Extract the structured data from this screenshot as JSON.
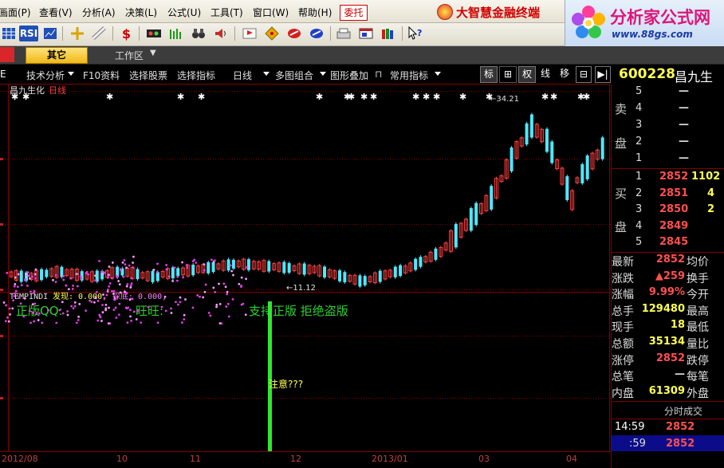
{
  "menu": [
    "画面(P)",
    "查看(V)",
    "分析(A)",
    "决策(L)",
    "公式(U)",
    "工具(T)",
    "窗口(W)",
    "帮助(H)"
  ],
  "weituo_label": "委托",
  "brand_text": "大智慧金融终端",
  "logo": {
    "title": "分析家公式网",
    "url": "www.88gs.com"
  },
  "toolbar_icons": [
    "grid-icon",
    "rsi-icon",
    "chart-grid-icon",
    "crosshair-icon",
    "ruler-icon",
    "dollar-icon",
    "dots-icon",
    "bars-icon",
    "binoculars-icon",
    "speaker-icon",
    "flag-icon",
    "diamond-icon",
    "red-ball-icon",
    "blue-ball-icon",
    "printer-icon",
    "window-icon",
    "books-icon",
    "help-cursor-icon"
  ],
  "toolbar_rsi": "RSI",
  "toolbar_dollar": "$",
  "tab": {
    "active_label": "其它",
    "workspace": "工作区",
    "arrow": "▼"
  },
  "funcbar": {
    "items": [
      "技术分析",
      "F10资料",
      "选择股票",
      "选择指标",
      "日线",
      "多图组合",
      "图形叠加",
      "常用指标"
    ],
    "right": [
      "标",
      "⊞",
      "权",
      "线",
      "移",
      "⊟",
      "▶|"
    ]
  },
  "stock": {
    "code": "600228",
    "name": "昌九生"
  },
  "chart": {
    "title": "昌九生化",
    "period": "日线",
    "high_label": "←34.21",
    "low_label": "←11.12",
    "indicator_name": "TEMPINDI",
    "indicator_found": "发现: 0.000,",
    "indicator_probe": "探底: 0.000,",
    "watermark_prefix": "正版QQ:",
    "watermark_mid": "旺旺:",
    "watermark_suffix": "支持正版  拒绝盗版",
    "notice": "注意???",
    "axis_dates": [
      "2012/08",
      "10",
      "11",
      "12",
      "2013/01",
      "03",
      "04"
    ]
  },
  "orderbook": {
    "sell_label": [
      "卖",
      "盘"
    ],
    "buy_label": [
      "买",
      "盘"
    ],
    "sells": [
      {
        "idx": "5",
        "price": "—",
        "vol": ""
      },
      {
        "idx": "4",
        "price": "—",
        "vol": ""
      },
      {
        "idx": "3",
        "price": "—",
        "vol": ""
      },
      {
        "idx": "2",
        "price": "—",
        "vol": ""
      },
      {
        "idx": "1",
        "price": "—",
        "vol": ""
      }
    ],
    "buys": [
      {
        "idx": "1",
        "price": "2852",
        "vol": "1102"
      },
      {
        "idx": "2",
        "price": "2851",
        "vol": "4"
      },
      {
        "idx": "3",
        "price": "2850",
        "vol": "2"
      },
      {
        "idx": "4",
        "price": "2849",
        "vol": ""
      },
      {
        "idx": "5",
        "price": "2845",
        "vol": ""
      }
    ]
  },
  "quote": [
    {
      "l": "最新",
      "v": "2852",
      "r": "均价",
      "color": "#ff5050"
    },
    {
      "l": "涨跌",
      "v": "▲259",
      "r": "换手",
      "color": "#ff5050"
    },
    {
      "l": "涨幅",
      "v": "9.99%",
      "r": "今开",
      "color": "#ff5050"
    },
    {
      "l": "总手",
      "v": "129480",
      "r": "最高",
      "color": "#ffff54"
    },
    {
      "l": "现手",
      "v": "18",
      "r": "最低",
      "color": "#ffff54"
    },
    {
      "l": "总额",
      "v": "35134",
      "r": "量比",
      "color": "#ffff54"
    },
    {
      "l": "涨停",
      "v": "2852",
      "r": "跌停",
      "color": "#ff5050"
    },
    {
      "l": "总笔",
      "v": "—",
      "r": "每笔",
      "color": "#ddd"
    },
    {
      "l": "内盘",
      "v": "61309",
      "r": "外盘",
      "color": "#ffff54"
    }
  ],
  "ticks": {
    "header": "分时成交",
    "rows": [
      {
        "time": "14:59",
        "price": "2852"
      },
      {
        "time": ":59",
        "price": "2852"
      }
    ]
  },
  "colors": {
    "up": "#ff4040",
    "down": "#4fe8ff",
    "grid": "#800000",
    "yellow": "#ffff54",
    "green": "#2fcf2f"
  }
}
